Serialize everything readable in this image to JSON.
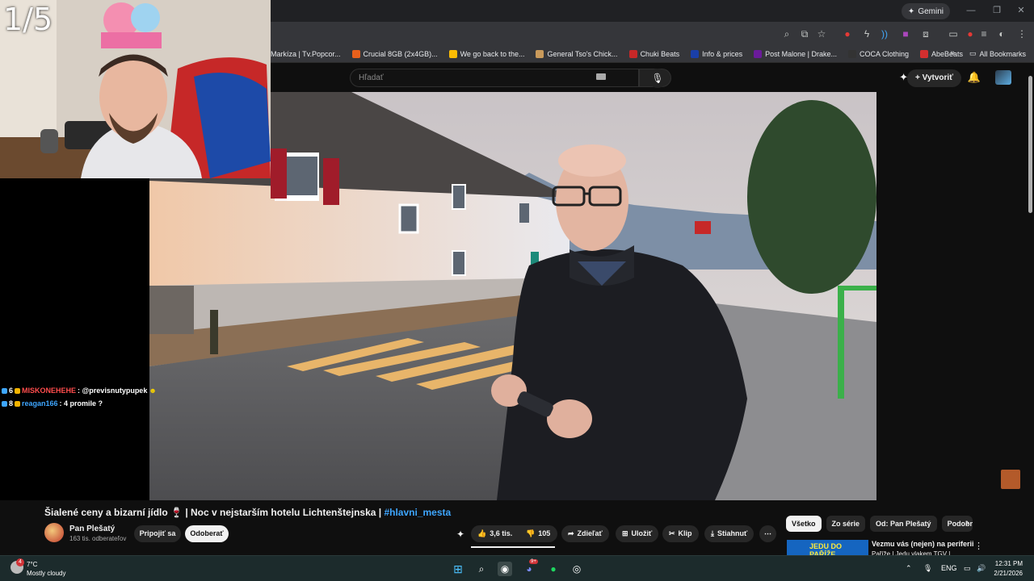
{
  "browser": {
    "gemini_label": "Gemini",
    "bookmarks": [
      {
        "label": "Markíza | Tv.Popcor...",
        "color": "#1a73e8"
      },
      {
        "label": "Crucial 8GB (2x4GB)...",
        "color": "#e8601c"
      },
      {
        "label": "We go back to the...",
        "color": "#fbbc04"
      },
      {
        "label": "General Tso's Chick...",
        "color": "#c99a5b"
      },
      {
        "label": "Chuki Beats",
        "color": "#c62828"
      },
      {
        "label": "Info & prices",
        "color": "#1a3fa8"
      },
      {
        "label": "Post Malone | Drake...",
        "color": "#6a1b9a"
      },
      {
        "label": "COCA Clothing",
        "color": "#333333"
      },
      {
        "label": "AbeBeats",
        "color": "#d32f2f"
      }
    ],
    "all_bookmarks": "All Bookmarks",
    "more": "»"
  },
  "overlay": {
    "counter": "1/5"
  },
  "chat": {
    "messages": [
      {
        "user": "MISKONEHEHE",
        "user_color": "#ff4d4d",
        "text": ": @previsnutypupek",
        "count": "6"
      },
      {
        "user": "reagan166",
        "user_color": "#3ea6ff",
        "text": ": 4 promile ?",
        "count": "8"
      }
    ]
  },
  "youtube": {
    "search_placeholder": "Hľadať",
    "create_label": "Vytvoriť",
    "video": {
      "title_main": "Šialené ceny a bizarní jídlo 🍷 | Noc v nejstarším hotelu Lichtenštejnska | ",
      "title_tag": "#hlavni_mesta"
    },
    "channel": {
      "name": "Pan Plešatý",
      "subscribers": "163 tis. odberateľov"
    },
    "join_label": "Pripojiť sa",
    "subscribe_label": "Odoberať",
    "actions": {
      "likes": "3,6 tis.",
      "dislikes": "105",
      "share": "Zdieľať",
      "save": "Uložiť",
      "clip": "Klip",
      "download": "Stiahnuť",
      "more": "⋯"
    },
    "chips": [
      "Všetko",
      "Zo série",
      "Od: Pan Plešatý",
      "Podobné"
    ],
    "recommended": {
      "title": "Vezmu vás (nejen) na periferii",
      "subtitle": "Paříže | Jedu vlakem TGV |",
      "thumb_text": "JEDU DO PAŘÍŽE"
    }
  },
  "taskbar": {
    "weather_badge": "4",
    "temperature": "7°C",
    "weather": "Mostly cloudy",
    "language": "ENG",
    "time": "12:31 PM",
    "date": "2/21/2026",
    "discord_badge": "9+"
  }
}
